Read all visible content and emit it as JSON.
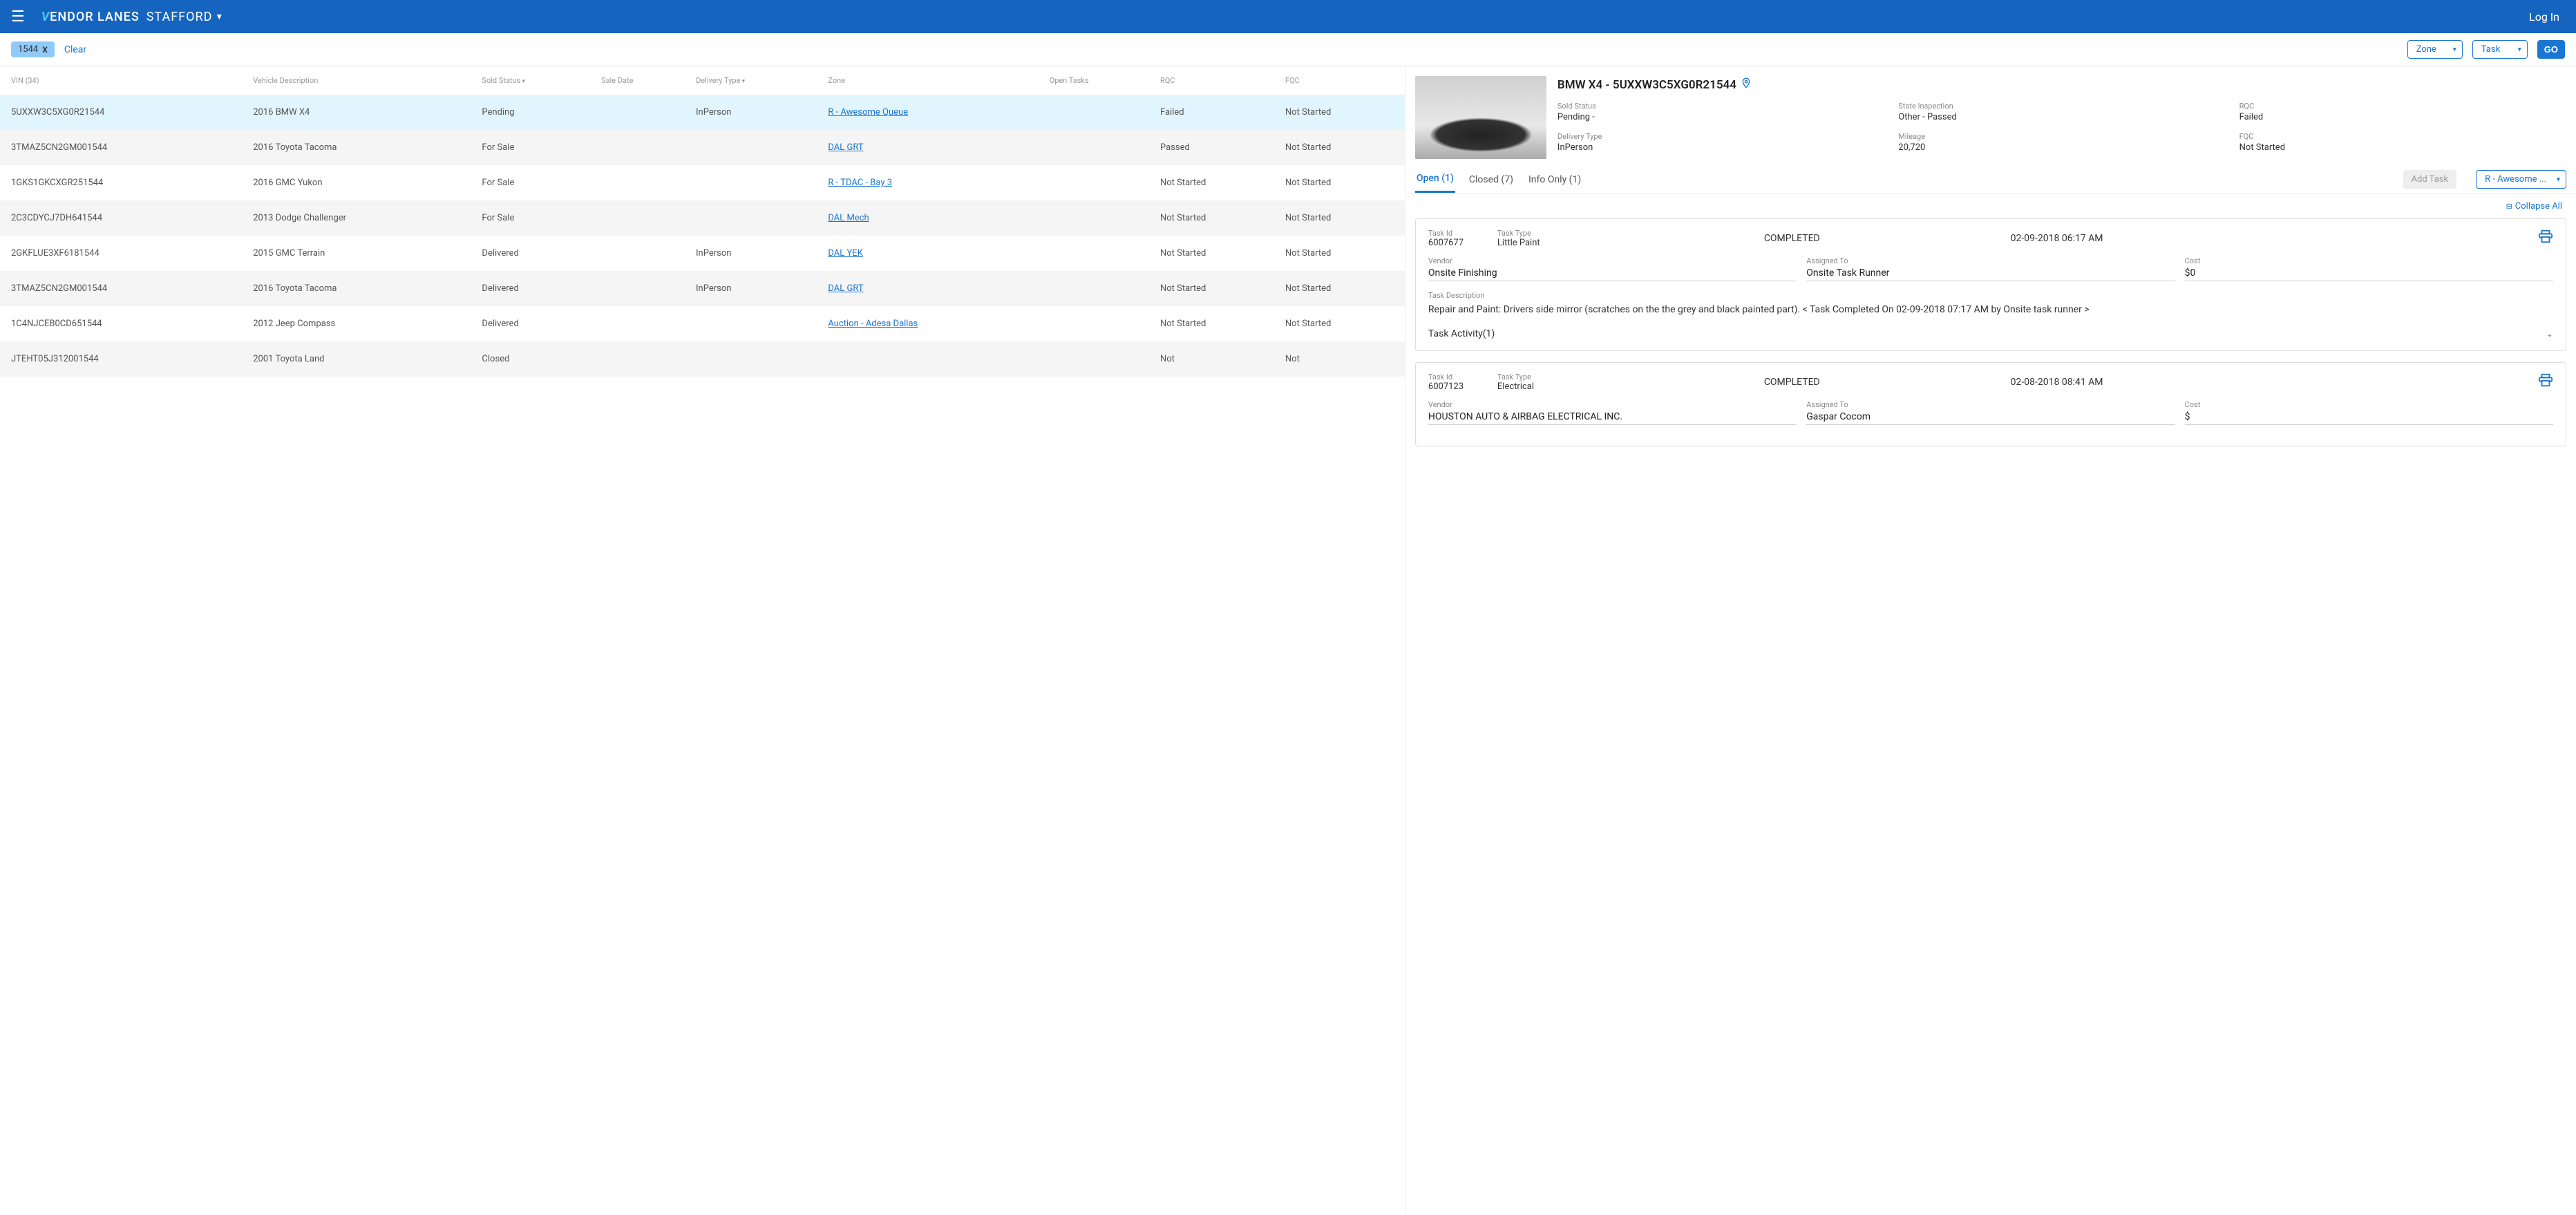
{
  "header": {
    "brand_prefix": "V",
    "brand_rest": "ENDOR LANES",
    "location": "STAFFORD",
    "login": "Log In"
  },
  "filterbar": {
    "chip": "1544",
    "chip_x": "X",
    "clear": "Clear",
    "zone": "Zone",
    "task": "Task",
    "go": "GO"
  },
  "table": {
    "headers": {
      "vin": "VIN (34)",
      "desc": "Vehicle Description",
      "sold": "Sold Status",
      "sale": "Sale Date",
      "delivery": "Delivery Type",
      "zone": "Zone",
      "opentasks": "Open Tasks",
      "rqc": "RQC",
      "fqc": "FQC"
    },
    "rows": [
      {
        "vin": "5UXXW3C5XG0R21544",
        "desc": "2016 BMW X4",
        "sold": "Pending",
        "delivery": "InPerson",
        "zone": "R - Awesome Queue",
        "rqc": "Failed",
        "fqc": "Not Started",
        "selected": true
      },
      {
        "vin": "3TMAZ5CN2GM001544",
        "desc": "2016 Toyota Tacoma",
        "sold": "For Sale",
        "delivery": "",
        "zone": "DAL GRT",
        "rqc": "Passed",
        "fqc": "Not Started"
      },
      {
        "vin": "1GKS1GKCXGR251544",
        "desc": "2016 GMC Yukon",
        "sold": "For Sale",
        "delivery": "",
        "zone": "R - TDAC - Bay 3",
        "rqc": "Not Started",
        "fqc": "Not Started"
      },
      {
        "vin": "2C3CDYCJ7DH641544",
        "desc": "2013 Dodge Challenger",
        "sold": "For Sale",
        "delivery": "",
        "zone": "DAL Mech",
        "rqc": "Not Started",
        "fqc": "Not Started"
      },
      {
        "vin": "2GKFLUE3XF6181544",
        "desc": "2015 GMC Terrain",
        "sold": "Delivered",
        "delivery": "InPerson",
        "zone": "DAL YEK",
        "rqc": "Not Started",
        "fqc": "Not Started"
      },
      {
        "vin": "3TMAZ5CN2GM001544",
        "desc": "2016 Toyota Tacoma",
        "sold": "Delivered",
        "delivery": "InPerson",
        "zone": "DAL GRT",
        "rqc": "Not Started",
        "fqc": "Not Started"
      },
      {
        "vin": "1C4NJCEB0CD651544",
        "desc": "2012 Jeep Compass",
        "sold": "Delivered",
        "delivery": "",
        "zone": "Auction - Adesa Dallas",
        "rqc": "Not Started",
        "fqc": "Not Started"
      },
      {
        "vin": "JTEHT05J312001544",
        "desc": "2001 Toyota Land",
        "sold": "Closed",
        "delivery": "",
        "zone": "",
        "rqc": "Not",
        "fqc": "Not"
      }
    ]
  },
  "detail": {
    "title": "BMW X4 - 5UXXW3C5XG0R21544",
    "meta": [
      {
        "lbl": "Sold Status",
        "val": "Pending -"
      },
      {
        "lbl": "State Inspection",
        "val": "Other - Passed"
      },
      {
        "lbl": "RQC",
        "val": "Failed"
      },
      {
        "lbl": "Delivery Type",
        "val": "InPerson"
      },
      {
        "lbl": "Mileage",
        "val": "20,720"
      },
      {
        "lbl": "FQC",
        "val": "Not Started"
      }
    ]
  },
  "tabs": {
    "open": "Open (1)",
    "closed": "Closed (7)",
    "info": "Info Only (1)",
    "addtask": "Add Task",
    "queue": "R - Awesome ...",
    "collapse": "Collapse All"
  },
  "tasks": [
    {
      "id_lbl": "Task Id",
      "id": "6007677",
      "type_lbl": "Task Type",
      "type": "Little Paint",
      "status": "COMPLETED",
      "date": "02-09-2018 06:17 AM",
      "vendor_lbl": "Vendor",
      "vendor": "Onsite Finishing",
      "assigned_lbl": "Assigned To",
      "assigned": "Onsite Task Runner",
      "cost_lbl": "Cost",
      "cost": "$0",
      "desc_lbl": "Task Description",
      "desc": "Repair and Paint: Drivers side mirror (scratches on the the grey and black painted part). < Task Completed On 02-09-2018 07:17 AM by Onsite task runner >",
      "activity": "Task Activity(1)"
    },
    {
      "id_lbl": "Task Id",
      "id": "6007123",
      "type_lbl": "Task Type",
      "type": "Electrical",
      "status": "COMPLETED",
      "date": "02-08-2018 08:41 AM",
      "vendor_lbl": "Vendor",
      "vendor": "HOUSTON AUTO & AIRBAG ELECTRICAL INC.",
      "assigned_lbl": "Assigned To",
      "assigned": "Gaspar Cocom",
      "cost_lbl": "Cost",
      "cost": "$"
    }
  ]
}
